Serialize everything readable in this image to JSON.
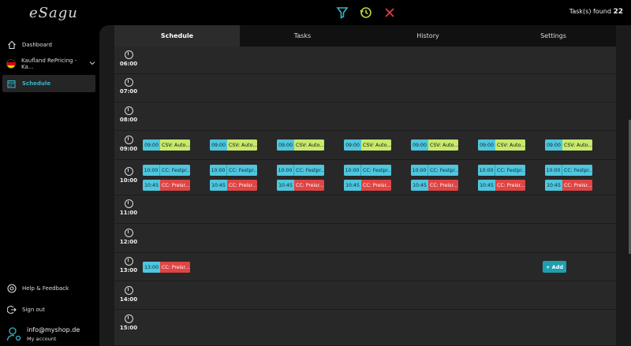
{
  "app": {
    "logo_text": "eSagu",
    "tasks_found_label": "Task(s) found",
    "tasks_found_count": "22"
  },
  "sidebar": {
    "dashboard": "Dashboard",
    "shop": "Kaufland RePricing - Ka...",
    "schedule": "Schedule",
    "help": "Help & Feedback",
    "signout": "Sign out",
    "account_email": "info@myshop.de",
    "account_label": "My account"
  },
  "tabs": [
    "Schedule",
    "Tasks",
    "History",
    "Settings"
  ],
  "hours": [
    "06:00",
    "07:00",
    "08:00",
    "09:00",
    "10:00",
    "11:00",
    "12:00",
    "13:00",
    "14:00",
    "15:00"
  ],
  "tasks": {
    "csv_time": "09:00",
    "csv_label": "CSV: Auto...",
    "cc1_time": "10:00",
    "cc1_label": "CC: Festpr...",
    "cc2_time": "10:45",
    "cc2_label": "CC: Preisr...",
    "cc3_time": "13:00",
    "cc3_label": "CC: Preisr..."
  },
  "add_button": "+ Add",
  "colors": {
    "accent": "#36b6c9",
    "csv": "#c8ea6c",
    "cc": "#4fc6dd",
    "red": "#e04444",
    "tab_indicator": "#9ec23a"
  }
}
